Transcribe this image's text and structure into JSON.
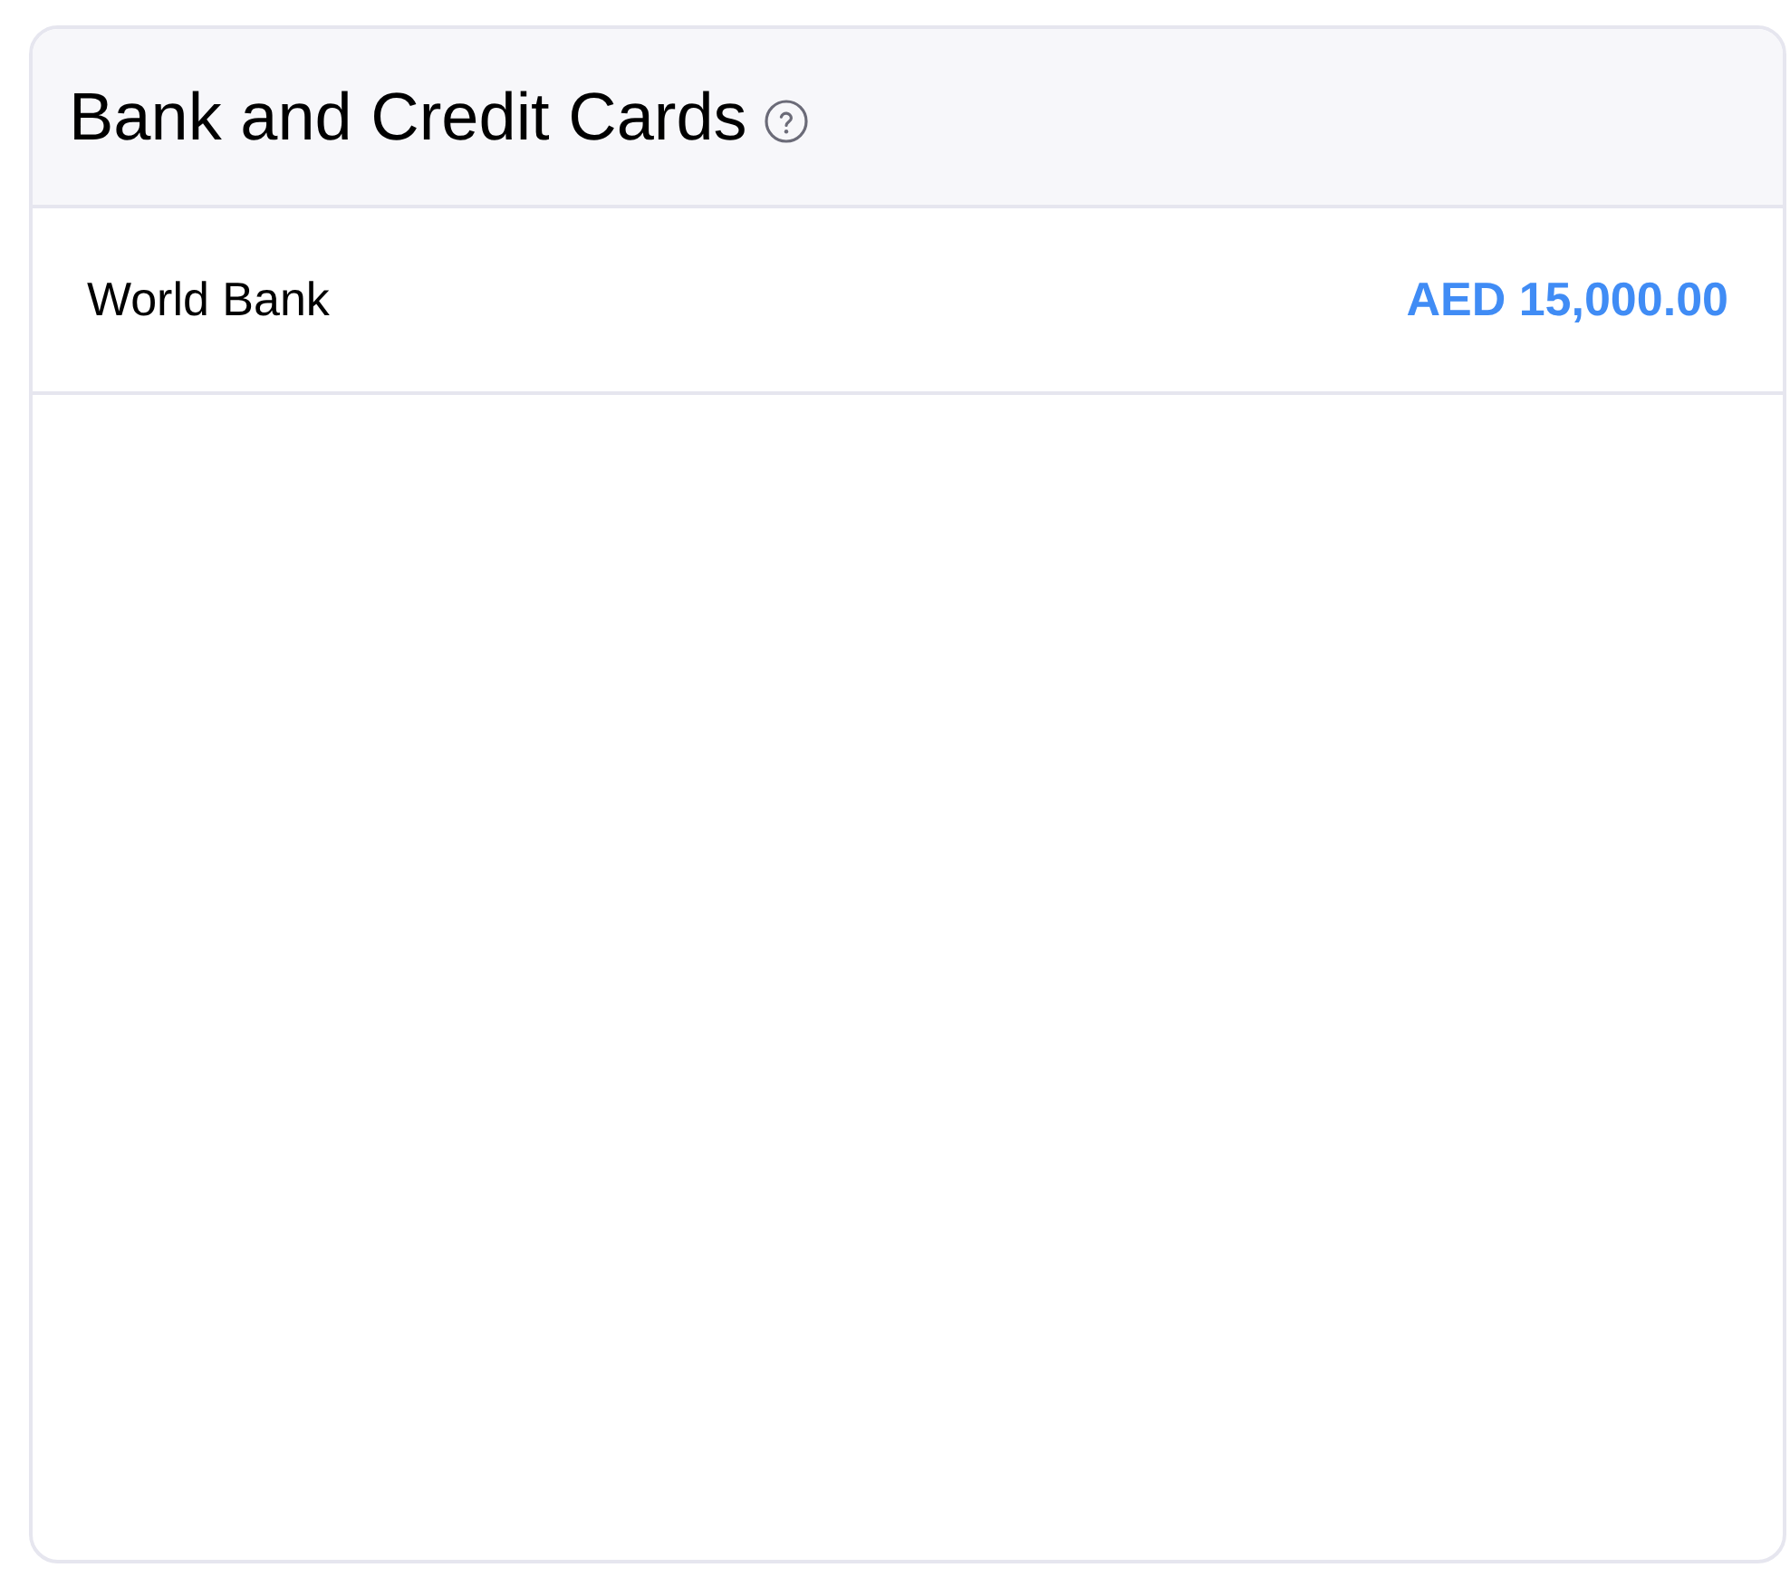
{
  "card": {
    "title": "Bank and Credit Cards"
  },
  "accounts": [
    {
      "name": "World Bank",
      "balance": "AED 15,000.00"
    }
  ]
}
